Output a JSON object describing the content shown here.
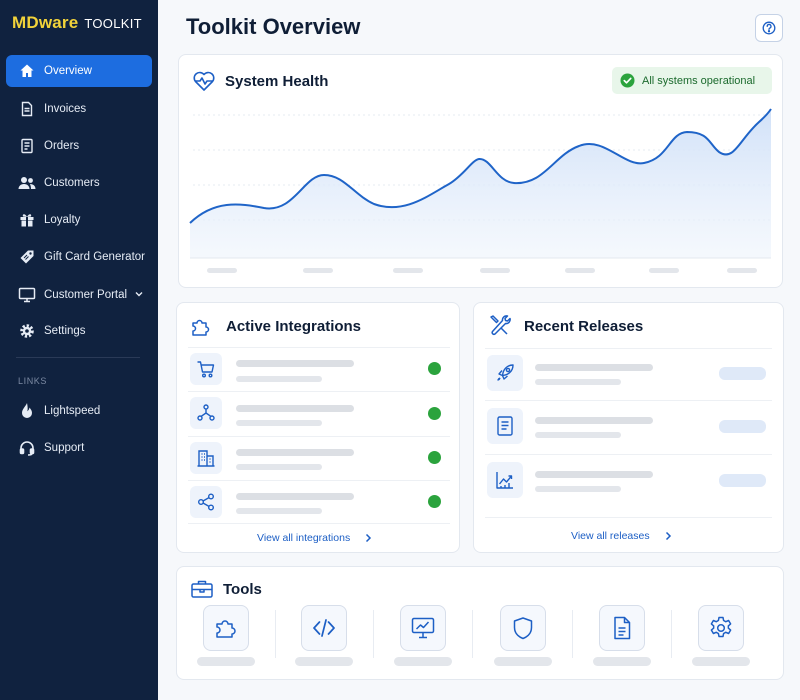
{
  "app": {
    "brand_main": "MDware",
    "brand_sub": "TOOLKIT"
  },
  "sidebar": {
    "items": [
      {
        "label": "Overview",
        "icon": "home-icon",
        "active": true
      },
      {
        "label": "Invoices",
        "icon": "invoice-icon"
      },
      {
        "label": "Orders",
        "icon": "orders-icon"
      },
      {
        "label": "Customers",
        "icon": "customers-icon"
      },
      {
        "label": "Loyalty",
        "icon": "gift-icon"
      },
      {
        "label": "Gift Card Generator",
        "icon": "tag-icon"
      },
      {
        "label": "Customer Portal",
        "icon": "monitor-icon",
        "expandable": true
      },
      {
        "label": "Settings",
        "icon": "gear-icon"
      }
    ],
    "links_heading": "LINKS",
    "links": [
      {
        "label": "Lightspeed",
        "icon": "lightspeed-icon"
      },
      {
        "label": "Support",
        "icon": "headset-icon"
      }
    ]
  },
  "page": {
    "title": "Toolkit Overview",
    "help_icon": "help-icon"
  },
  "system_health": {
    "title": "System Health",
    "icon": "heartbeat-icon",
    "status": "All systems operational",
    "status_color": "#2ba33d"
  },
  "integrations": {
    "title": "Active Integrations",
    "icon": "puzzle-icon",
    "rows": [
      {
        "icon": "cart-icon",
        "status_color": "#2ba33d"
      },
      {
        "icon": "network-icon",
        "status_color": "#2ba33d"
      },
      {
        "icon": "building-icon",
        "status_color": "#2ba33d"
      },
      {
        "icon": "share-icon",
        "status_color": "#2ba33d"
      }
    ],
    "link_label": "View all integrations"
  },
  "releases": {
    "title": "Recent Releases",
    "icon": "tools-icon",
    "rows": [
      {
        "icon": "rocket-icon"
      },
      {
        "icon": "document-icon"
      },
      {
        "icon": "trend-icon"
      }
    ],
    "link_label": "View all releases"
  },
  "tools": {
    "title": "Tools",
    "icon": "toolbox-icon",
    "items": [
      {
        "icon": "puzzle-icon"
      },
      {
        "icon": "code-icon"
      },
      {
        "icon": "monitor-chart-icon"
      },
      {
        "icon": "shield-icon"
      },
      {
        "icon": "document-icon"
      },
      {
        "icon": "gear-icon"
      }
    ]
  },
  "colors": {
    "sidebar_bg": "#10223f",
    "accent": "#1d6de0",
    "brand_yellow": "#f2d33a",
    "success": "#2ba33d"
  }
}
